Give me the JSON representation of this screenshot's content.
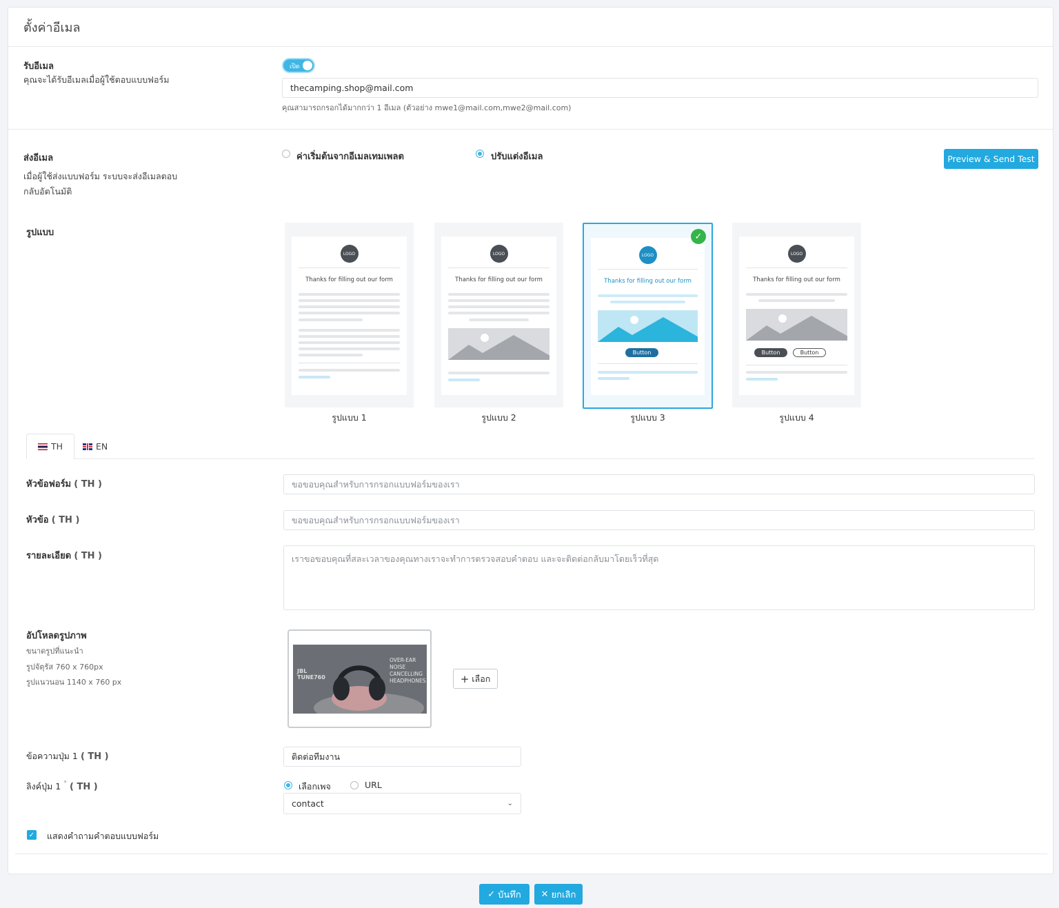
{
  "page": {
    "title": "ตั้งค่าอีเมล"
  },
  "receive": {
    "label": "รับอีเมล",
    "description": "คุณจะได้รับอีเมลเมื่อผู้ใช้ตอบแบบฟอร์ม",
    "toggle_label": "เปิด",
    "toggle_on": true,
    "email_value": "thecamping.shop@mail.com",
    "hint": "คุณสามารถกรอกได้มากกว่า 1 อีเมล (ตัวอย่าง mwe1@mail.com,mwe2@mail.com)"
  },
  "send": {
    "label": "ส่งอีเมล",
    "description_line1": "เมื่อผู้ใช้ส่งแบบฟอร์ม ระบบจะส่งอีเมลตอบ",
    "description_line2": "กลับอัตโนมัติ",
    "option_default": "ค่าเริ่มต้นจากอีเมลเทมเพลต",
    "option_custom": "ปรับแต่งอีเมล",
    "selected_option": "custom",
    "preview_button": "Preview & Send Test"
  },
  "templates": {
    "label": "รูปแบบ",
    "selected": 3,
    "items": [
      {
        "label": "รูปแบบ 1",
        "logo": "LOGO",
        "title": "Thanks for filling out our form"
      },
      {
        "label": "รูปแบบ 2",
        "logo": "LOGO",
        "title": "Thanks for filling out our form"
      },
      {
        "label": "รูปแบบ 3",
        "logo": "LOGO",
        "title": "Thanks for filling out our form",
        "button": "Button"
      },
      {
        "label": "รูปแบบ 4",
        "logo": "LOGO",
        "title": "Thanks for filling out our form",
        "button1": "Button",
        "button2": "Button"
      }
    ]
  },
  "tabs": [
    {
      "label": "TH",
      "active": true
    },
    {
      "label": "EN",
      "active": false
    }
  ],
  "fields": {
    "form_title_label": "หัวข้อฟอร์ม",
    "form_title_lang": "( TH )",
    "form_title_placeholder": "ขอขอบคุณสำหรับการกรอกแบบฟอร์มของเรา",
    "subject_label": "หัวข้อ",
    "subject_lang": "( TH )",
    "subject_placeholder": "ขอขอบคุณสำหรับการกรอกแบบฟอร์มของเรา",
    "detail_label": "รายละเอียด",
    "detail_lang": "( TH )",
    "detail_placeholder": "เราขอขอบคุณที่สละเวลาของคุณทางเราจะทำการตรวจสอบคำตอบ และจะติดต่อกลับมาโดยเร็วที่สุด"
  },
  "upload": {
    "label": "อัปโหลดรูปภาพ",
    "size_title": "ขนาดรูปที่แนะนำ",
    "size_square": "รูปจัตุรัส 760 x 760px",
    "size_landscape": "รูปแนวนอน 1140 x 760 px",
    "choose_button": "เลือก",
    "photo_brand": "JBL",
    "photo_model": "TUNE760",
    "photo_caption_1": "OVER-EAR",
    "photo_caption_2": "NOISE",
    "photo_caption_3": "CANCELLING",
    "photo_caption_4": "HEADPHONES"
  },
  "button1": {
    "text_label": "ข้อความปุ่ม 1",
    "text_lang": "( TH )",
    "text_value": "ติดต่อทีมงาน",
    "link_label": "ลิงค์ปุ่ม 1",
    "link_required": "*",
    "link_lang": "( TH )",
    "link_option_page": "เลือกเพจ",
    "link_option_url": "URL",
    "link_selected": "page",
    "page_value": "contact"
  },
  "show_answers": {
    "label": "แสดงคำถามคำตอบแบบฟอร์ม",
    "checked": true
  },
  "actions": {
    "save": "บันทึก",
    "cancel": "ยกเลิก"
  },
  "colors": {
    "accent": "#22a9df",
    "success": "#35b449"
  }
}
